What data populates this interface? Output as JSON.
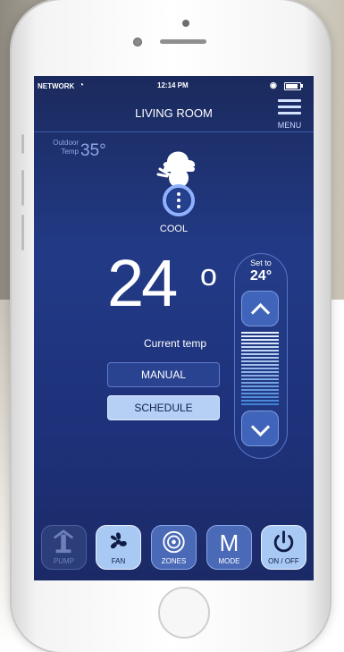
{
  "status_bar": {
    "carrier": "NETWORK",
    "time": "12:14 PM",
    "battery_level": 0.85
  },
  "header": {
    "title": "LIVING ROOM",
    "menu_label": "MENU"
  },
  "outdoor": {
    "label_line1": "Outdoor",
    "label_line2": "Temp",
    "value": "35°"
  },
  "mode": {
    "icon": "snowman-icon",
    "label": "COOL"
  },
  "current": {
    "temp": "24",
    "degree": "o",
    "label": "Current temp"
  },
  "buttons": {
    "manual": "MANUAL",
    "schedule": "SCHEDULE"
  },
  "setpoint": {
    "label": "Set to",
    "value": "24°"
  },
  "tabs": [
    {
      "label": "PUMP",
      "icon": "pump-icon",
      "state": "disabled"
    },
    {
      "label": "FAN",
      "icon": "fan-icon",
      "state": "active"
    },
    {
      "label": "ZONES",
      "icon": "zones-icon",
      "state": "normal"
    },
    {
      "label": "MODE",
      "icon": "mode-icon",
      "state": "normal",
      "glyph": "M"
    },
    {
      "label": "ON / OFF",
      "icon": "power-icon",
      "state": "active"
    }
  ],
  "colors": {
    "screen_bg": "#223a86",
    "accent_light": "#b6d0f5",
    "accent": "#4a6ab8"
  }
}
